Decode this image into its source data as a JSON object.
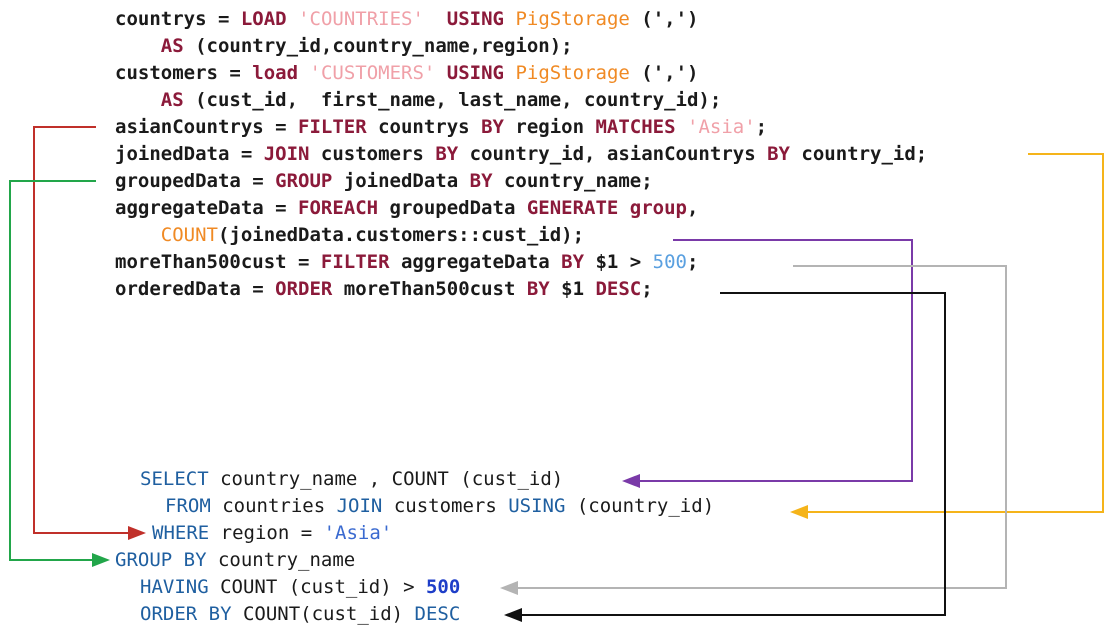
{
  "pig": {
    "l1": [
      "countrys = ",
      "LOAD",
      " ",
      "'COUNTRIES'",
      "  ",
      "USING",
      " ",
      "PigStorage",
      " (',')"
    ],
    "l2": [
      "    ",
      "AS",
      " (country_id,country_name,region);"
    ],
    "l3": [
      "customers = ",
      "load",
      " ",
      "'CUSTOMERS'",
      " ",
      "USING",
      " ",
      "PigStorage",
      " (',')"
    ],
    "l4": [
      "    ",
      "AS",
      " (cust_id,  first_name, last_name, country_id);"
    ],
    "l5": [
      "asianCountrys = ",
      "FILTER",
      " countrys ",
      "BY",
      " region ",
      "MATCHES",
      " ",
      "'Asia'",
      ";"
    ],
    "l6": [
      "joinedData = ",
      "JOIN",
      " customers ",
      "BY",
      " country_id, asianCountrys ",
      "BY",
      " country_id;"
    ],
    "l7": [
      "groupedData = ",
      "GROUP",
      " joinedData ",
      "BY",
      " country_name;"
    ],
    "l8": [
      "aggregateData = ",
      "FOREACH",
      " groupedData ",
      "GENERATE",
      " ",
      "group",
      ","
    ],
    "l9": [
      "    ",
      "COUNT",
      "(joinedData.customers::cust_id);"
    ],
    "l10": [
      "moreThan500cust = ",
      "FILTER",
      " aggregateData ",
      "BY",
      " $1 > ",
      "500",
      ";"
    ],
    "l11": [
      "orderedData = ",
      "ORDER",
      " moreThan500cust ",
      "BY",
      " $1 ",
      "DESC",
      ";"
    ]
  },
  "sql": {
    "s1": [
      "SELECT",
      " country_name , COUNT (cust_id)"
    ],
    "s2": [
      "FROM",
      " countries ",
      "JOIN",
      " customers ",
      "USING",
      " (country_id)"
    ],
    "s3": [
      "WHERE",
      " region = ",
      "'Asia'"
    ],
    "s4": [
      "GROUP BY",
      " country_name"
    ],
    "s5": [
      "HAVING",
      " COUNT (cust_id) > ",
      "500"
    ],
    "s6": [
      "ORDER BY",
      " COUNT(cust_id) ",
      "DESC"
    ]
  },
  "arrow_colors": {
    "filter_where": "#c0302a",
    "group": "#22a64a",
    "join": "#f5b41a",
    "count": "#7a3aa8",
    "having": "#b4b4b4",
    "order": "#111111"
  }
}
